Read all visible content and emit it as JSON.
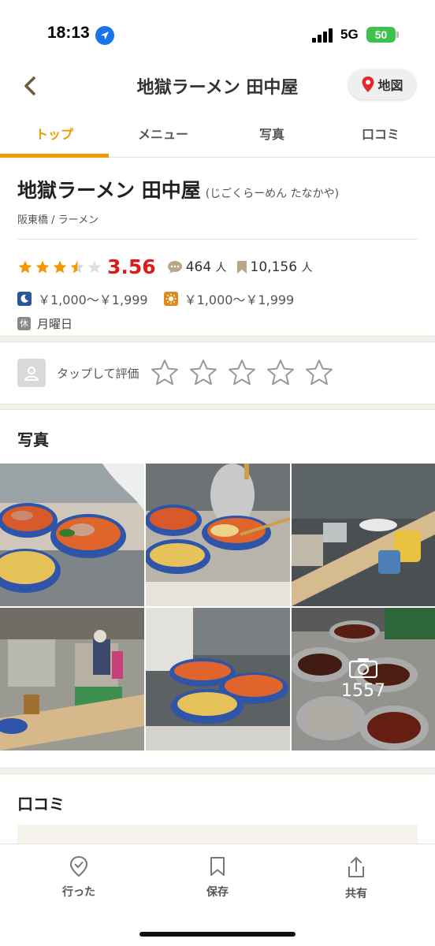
{
  "status_bar": {
    "time": "18:13",
    "network": "5G",
    "battery": "50"
  },
  "nav": {
    "title": "地獄ラーメン 田中屋",
    "map_label": "地図"
  },
  "tabs": [
    {
      "label": "トップ",
      "active": true
    },
    {
      "label": "メニュー",
      "active": false
    },
    {
      "label": "写真",
      "active": false
    },
    {
      "label": "口コミ",
      "active": false
    }
  ],
  "shop": {
    "name": "地獄ラーメン 田中屋",
    "kana": "(じごくらーめん たなかや)",
    "genre": "阪東橋 / ラーメン",
    "rating": "3.56",
    "rating_stars": 3.5,
    "review_count": "464",
    "save_count": "10,156",
    "count_unit": "人",
    "dinner_price": "￥1,000～￥1,999",
    "lunch_price": "￥1,000～￥1,999",
    "holiday_badge": "休",
    "holiday": "月曜日"
  },
  "rate": {
    "label": "タップして評価"
  },
  "photos": {
    "heading": "写真",
    "count": "1557"
  },
  "reviews": {
    "heading": "口コミ"
  },
  "bottom_bar": {
    "went": "行った",
    "save": "保存",
    "share": "共有"
  },
  "colors": {
    "accent": "#f39800",
    "rating": "#dc1a1a",
    "dinner_icon": "#2b5797",
    "lunch_icon": "#e08a1e"
  },
  "icons": {
    "back": "chevron-left-icon",
    "map": "map-pin-icon",
    "review": "chat-bubble-icon",
    "save": "bookmark-icon",
    "dinner": "moon-icon",
    "lunch": "sun-icon",
    "avatar": "user-icon",
    "camera": "camera-icon",
    "went": "check-pin-icon",
    "share": "share-icon"
  }
}
